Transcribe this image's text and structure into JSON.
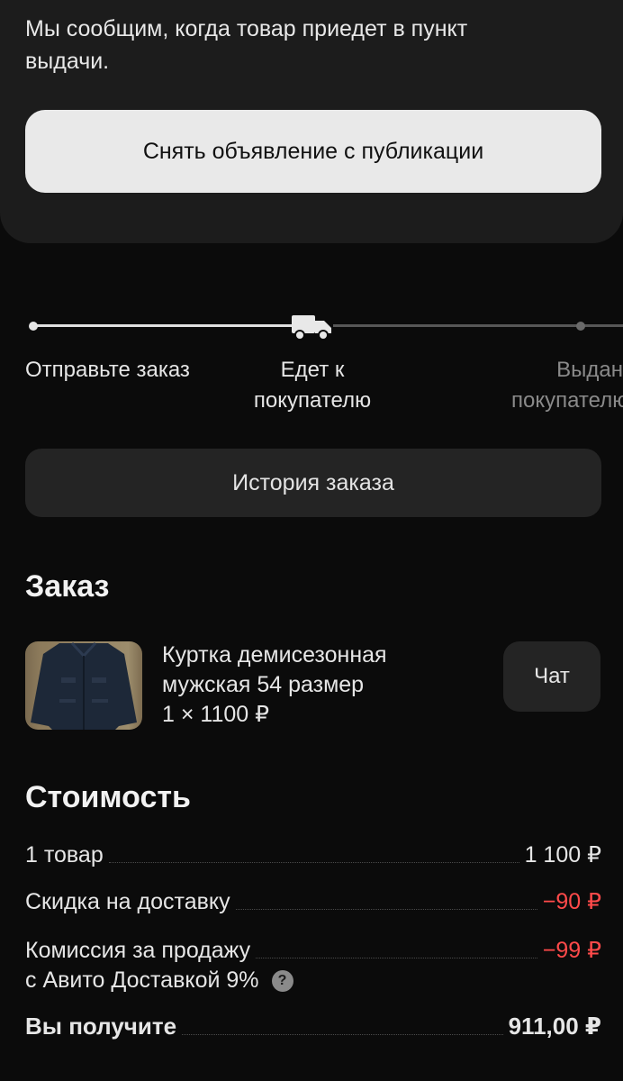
{
  "notice": {
    "text": "Мы сообщим, когда товар приедет в пункт выдачи.",
    "unpublish_label": "Снять объявление с публикации"
  },
  "tracker": {
    "steps": [
      {
        "label": "Отправьте заказ",
        "state": "done"
      },
      {
        "label": "Едет к покупателю",
        "state": "current",
        "icon": "truck-icon"
      },
      {
        "line1": "Выдан",
        "line2": "покупателю",
        "state": "pending"
      }
    ],
    "colors": {
      "done": "#e0e0e0",
      "pending": "#575757"
    }
  },
  "history_label": "История заказа",
  "order": {
    "title": "Заказ",
    "item": {
      "name_line1": "Куртка демисезонная",
      "name_line2": "мужская 54 размер",
      "qty_price": "1 × 1100 ₽"
    },
    "chat_label": "Чат"
  },
  "cost": {
    "title": "Стоимость",
    "rows": [
      {
        "label": "1 товар",
        "value": "1 100 ₽"
      },
      {
        "label": "Скидка на доставку",
        "value": "−90 ₽"
      },
      {
        "label": "Комиссия за продажу",
        "label2": "с Авито Доставкой 9%",
        "value": "−99 ₽"
      }
    ],
    "total": {
      "label": "Вы получите",
      "value": "911,00 ₽"
    },
    "negative_color": "#ff4a4a"
  }
}
